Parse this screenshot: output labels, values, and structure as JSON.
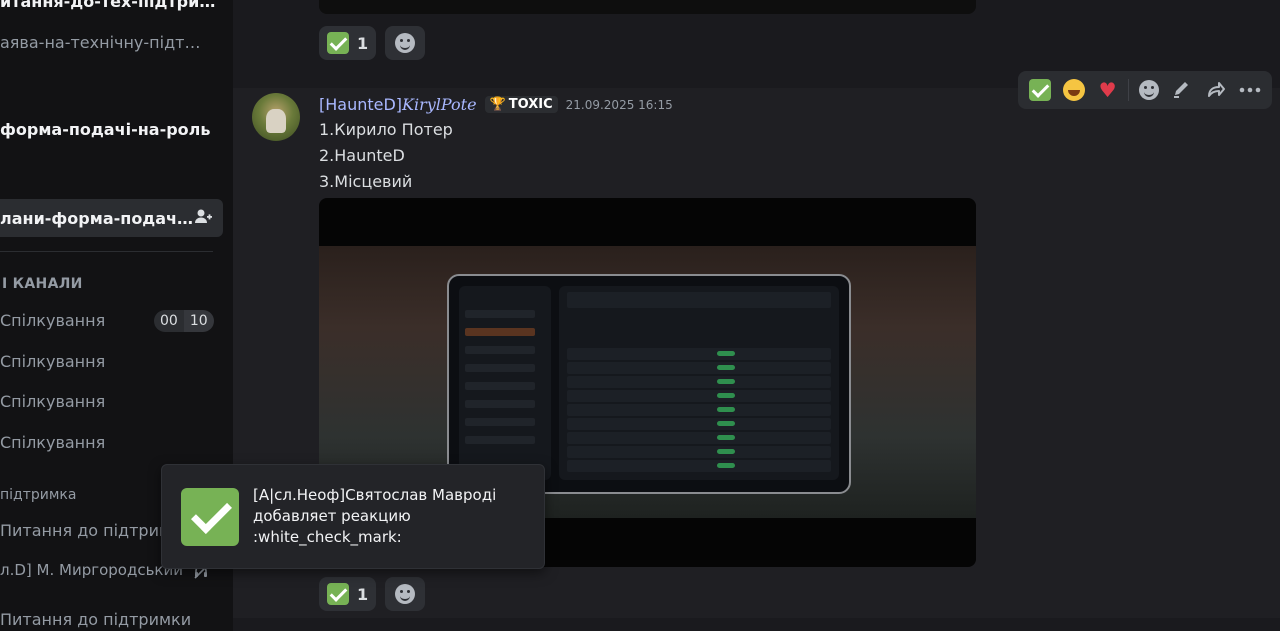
{
  "sidebar": {
    "items": [
      {
        "label": "итання-до-тех-підтри…",
        "style": "bold"
      },
      {
        "label": "аява-на-технічну-підт…",
        "style": "muted"
      },
      {
        "label": "форма-подачі-на-роль",
        "style": "bold"
      },
      {
        "label": "лани-форма-подач…",
        "style": "bold"
      }
    ],
    "section_header": "І КАНАЛИ",
    "voice": [
      {
        "label": "Спілкування"
      },
      {
        "label": "Спілкування"
      },
      {
        "label": "Спілкування"
      },
      {
        "label": "Спілкування"
      }
    ],
    "voice_timer": {
      "left": "00",
      "right": "10"
    },
    "support_header": "підтримка",
    "support_items": [
      {
        "label": "Питання до підтримки"
      },
      {
        "label": "л.D] М. Миргородський"
      },
      {
        "label": "Питання до підтримки"
      }
    ]
  },
  "prev_message": {
    "reaction_count": "1"
  },
  "message": {
    "author_prefix": "[HaunteD]",
    "author_name": "KirylPote",
    "tag": "TOXIC",
    "timestamp": "21.09.2025 16:15",
    "lines": [
      "1.Кирило Потер",
      "2.HaunteD",
      "3.Місцевий"
    ],
    "reaction_count": "1"
  },
  "toolbar": {
    "icons": [
      "white-check-mark",
      "joy",
      "heart",
      "add-reaction",
      "edit",
      "forward",
      "more"
    ]
  },
  "toast": {
    "text_line1": "[А|сл.Неоф]Святослав Мавроді",
    "text_line2": "добавляет реакцию",
    "text_line3": ":white_check_mark:"
  },
  "colors": {
    "check_green": "#77b255",
    "username_blue": "#a9b8ff",
    "heart_red": "#e03b4b"
  }
}
